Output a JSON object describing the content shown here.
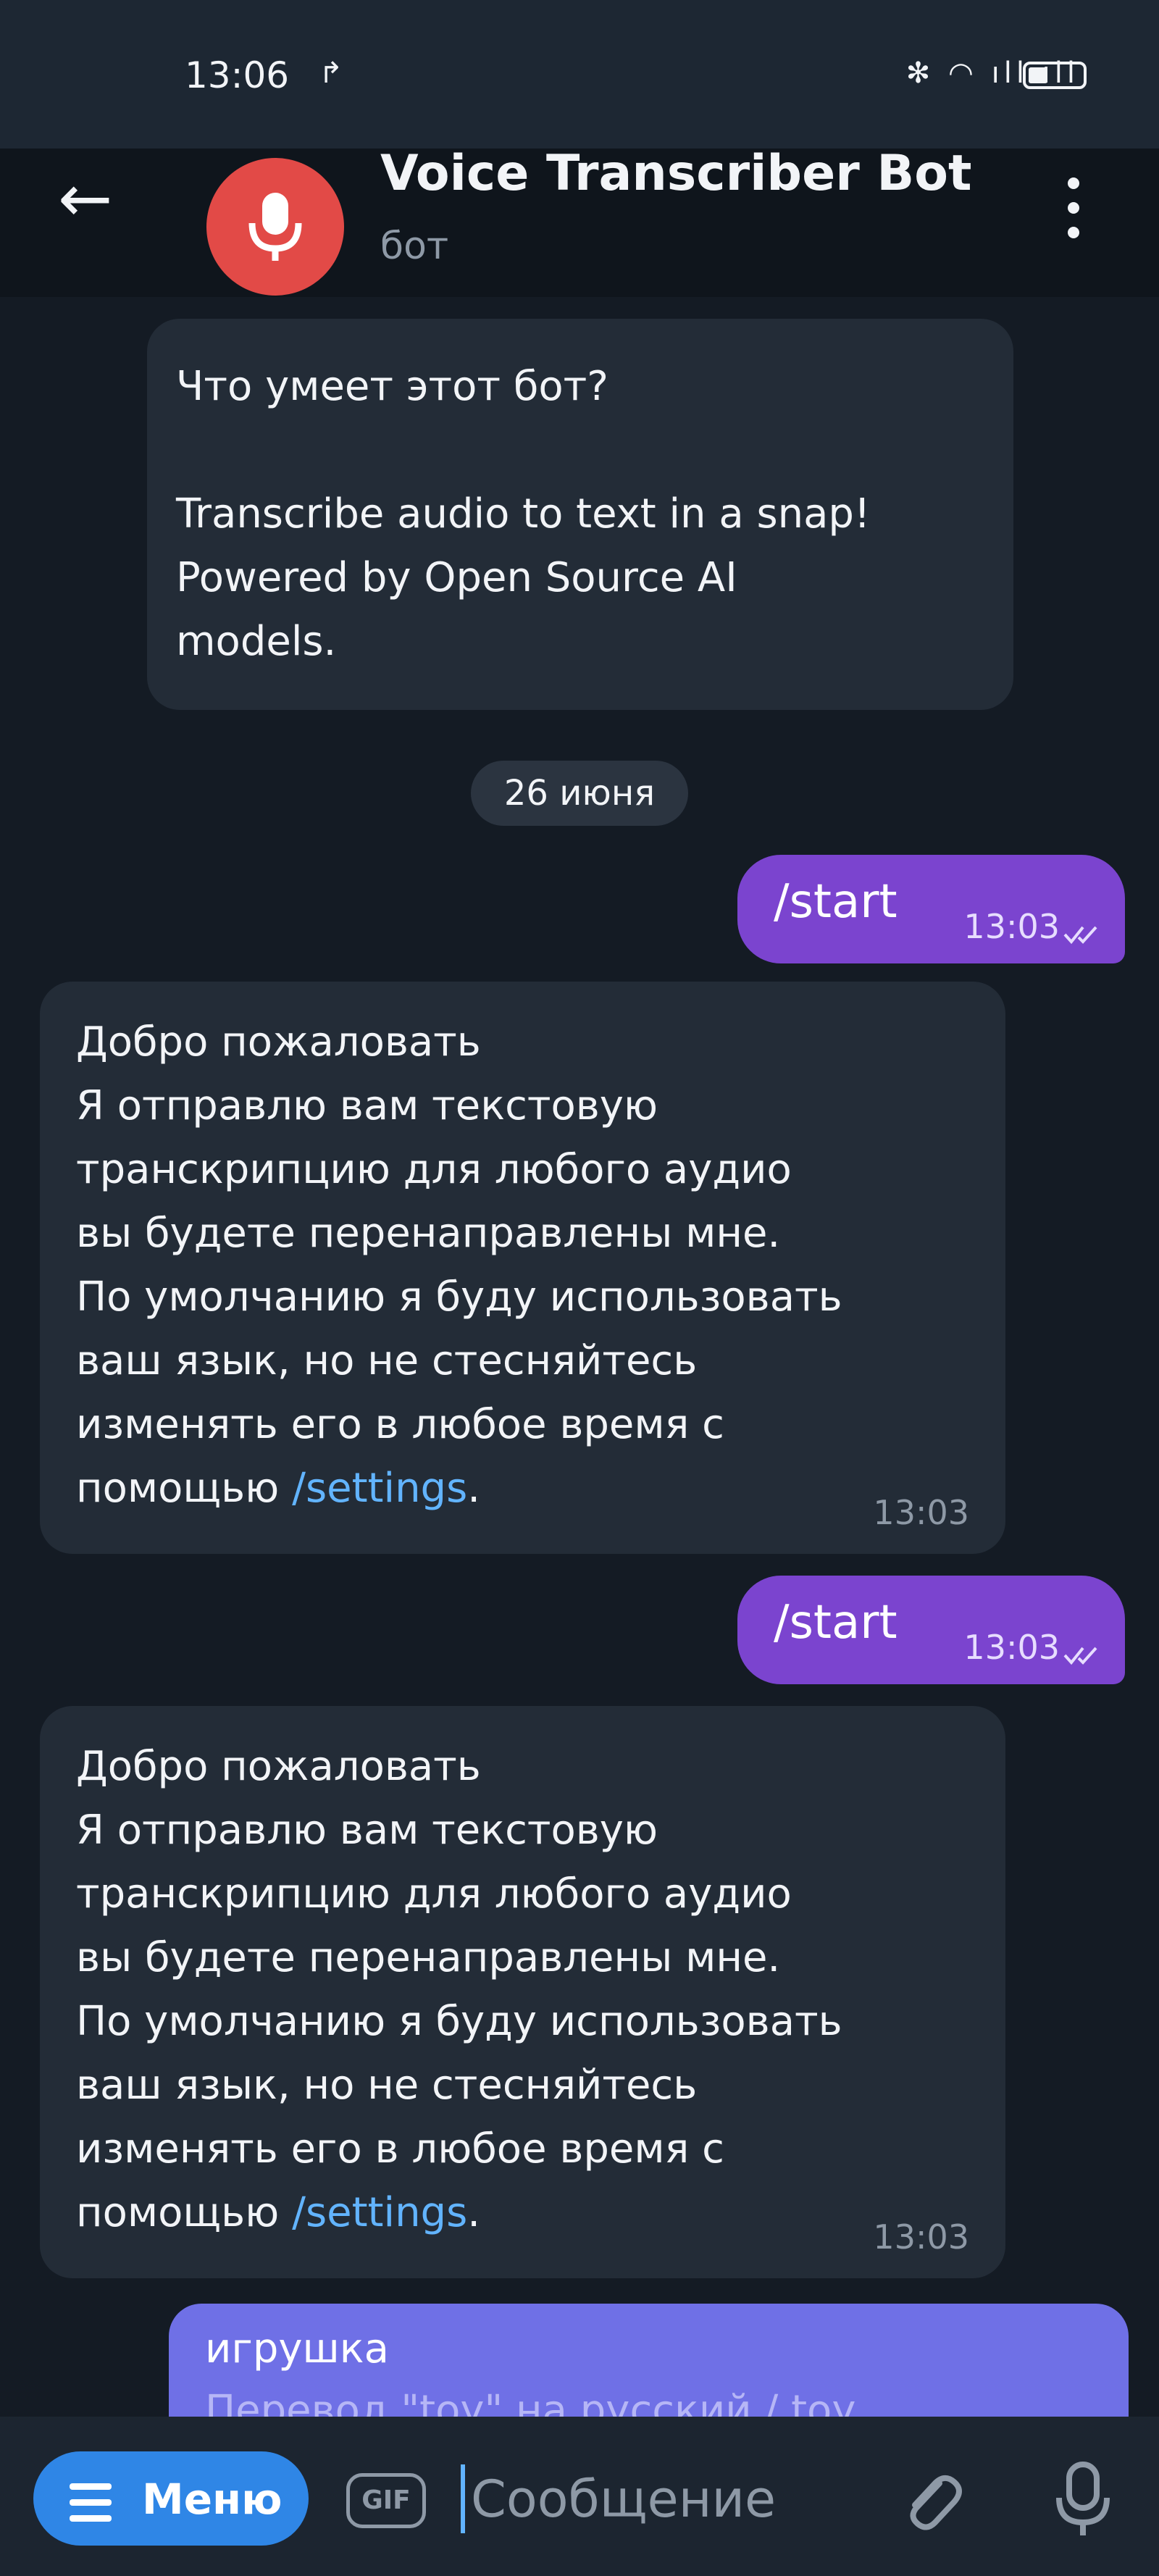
{
  "status": {
    "time": "13:06",
    "icons": "✻ ◠ ıll ıll"
  },
  "header": {
    "title": "Voice Transcriber Bot",
    "subtitle": "бот"
  },
  "intro": {
    "text": "Что умеет этот бот?\n\nTranscribe audio to text in a snap!\nPowered by Open Source AI\nmodels."
  },
  "date_label": "26 июня",
  "messages": [
    {
      "type": "out",
      "text": "/start",
      "time": "13:03"
    },
    {
      "type": "in",
      "text": "Добро пожаловать\nЯ отправлю вам текстовую\nтранскрипцию для любого аудио\nвы будете перенаправлены мне.\nПо умолчанию я буду использовать\nваш язык, но не стесняйтесь\nизменять его в любое время с\nпомощью",
      "link": "/settings",
      "after": ".",
      "time": "13:03"
    },
    {
      "type": "out",
      "text": "/start",
      "time": "13:03"
    },
    {
      "type": "in",
      "text": "Добро пожаловать\nЯ отправлю вам текстовую\nтранскрипцию для любого аудио\nвы будете перенаправлены мне.\nПо умолчанию я буду использовать\nваш язык, но не стесняйтесь\nизменять его в любое время с\nпомощью",
      "link": "/settings",
      "after": ".",
      "time": "13:03"
    }
  ],
  "last_message": {
    "title": "игрушка",
    "clipped": "Перевод \"toy\" на русский / toy"
  },
  "input": {
    "menu_label": "Меню",
    "gif_label": "GIF",
    "placeholder": "Сообщение"
  }
}
